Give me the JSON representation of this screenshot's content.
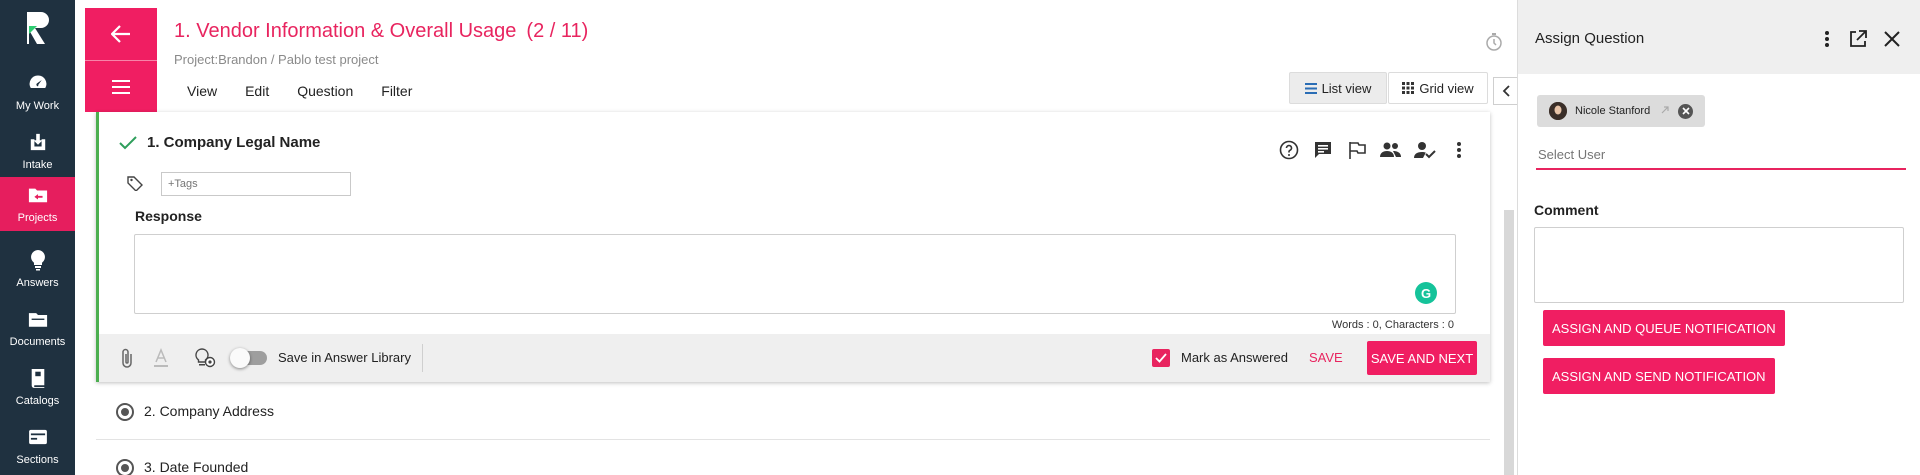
{
  "nav": {
    "logo": "R",
    "items": [
      {
        "label": "My Work",
        "icon": "dashboard-gauge-icon"
      },
      {
        "label": "Intake",
        "icon": "inbox-download-icon"
      },
      {
        "label": "Projects",
        "icon": "projects-folder-icon",
        "active": true
      },
      {
        "label": "Answers",
        "icon": "lightbulb-icon"
      },
      {
        "label": "Documents",
        "icon": "folder-icon"
      },
      {
        "label": "Catalogs",
        "icon": "catalog-books-icon"
      },
      {
        "label": "Sections",
        "icon": "sections-card-icon"
      }
    ]
  },
  "header": {
    "title": "1. Vendor Information & Overall Usage",
    "count": "(2 / 11)",
    "subtitle": "Project:Brandon / Pablo test project",
    "menu": [
      "View",
      "Edit",
      "Question",
      "Filter"
    ],
    "list_view": "List view",
    "grid_view": "Grid view"
  },
  "question": {
    "title": "1. Company Legal Name",
    "tags_placeholder": "+Tags",
    "response_label": "Response",
    "counts": "Words : 0, Characters : 0",
    "save_library": "Save in Answer Library",
    "mark_answered": "Mark as Answered",
    "save": "SAVE",
    "save_next": "SAVE AND NEXT",
    "grammarly": "G"
  },
  "other_questions": [
    "2. Company Address",
    "3. Date Founded"
  ],
  "panel": {
    "title": "Assign Question",
    "chip_name": "Nicole Stanford",
    "select_placeholder": "Select User",
    "comment_label": "Comment",
    "btn_queue": "ASSIGN AND QUEUE NOTIFICATION",
    "btn_send": "ASSIGN AND SEND NOTIFICATION"
  },
  "colors": {
    "brand": "#f01e62",
    "nav_bg": "#1f3140",
    "answered_accent": "#4caf50"
  }
}
